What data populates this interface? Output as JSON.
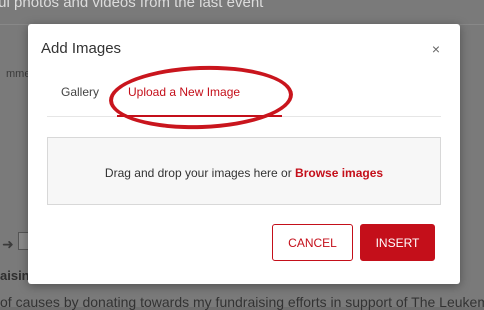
{
  "background": {
    "top_text": "ful photos and videos from the last event",
    "left_text": "mme",
    "heading": "aising",
    "bottom_text": "of causes by donating towards my fundraising efforts in support of The Leukemia"
  },
  "modal": {
    "title": "Add Images",
    "close_icon": "×",
    "tabs": [
      {
        "label": "Gallery"
      },
      {
        "label": "Upload a New Image"
      }
    ],
    "dropzone": {
      "text": "Drag and drop your images here or ",
      "browse_label": "Browse images"
    },
    "buttons": {
      "cancel_label": "CANCEL",
      "insert_label": "INSERT"
    }
  },
  "colors": {
    "accent": "#c40f1a",
    "overlay": "#707070"
  },
  "annotation": {
    "type": "red-ellipse",
    "target": "Upload a New Image"
  }
}
